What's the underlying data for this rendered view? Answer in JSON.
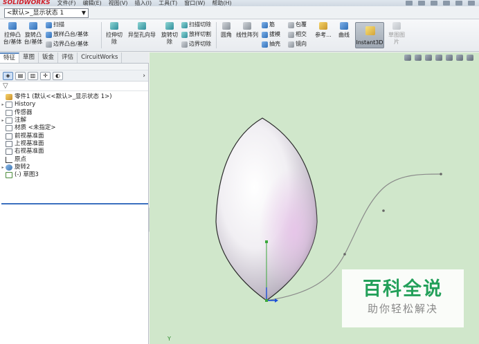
{
  "app": {
    "logo": "SOLIDWORKS",
    "menus": [
      "文件(F)",
      "编辑(E)",
      "视图(V)",
      "插入(I)",
      "工具(T)",
      "窗口(W)",
      "帮助(H)"
    ]
  },
  "config": {
    "selected": "<默认>_显示状态 1"
  },
  "ribbon": {
    "extrude_boss": "拉伸凸\n台/基体",
    "revolve_boss": "旋转凸\n台/基体",
    "sweep": "扫描",
    "loft": "放样凸台/基体",
    "boundary": "边界凸台/基体",
    "extrude_cut": "拉伸切\n除",
    "hole_wizard": "异型孔向导",
    "revolve_cut": "旋转切\n除",
    "swept_cut": "扫描切除",
    "lofted_cut": "放样切割",
    "boundary_cut": "边界切除",
    "fillet": "圆角",
    "linear_pattern": "线性阵列",
    "rib": "筋",
    "draft": "拔模",
    "shell": "抽壳",
    "wrap": "包覆",
    "intersect": "相交",
    "mirror": "镜向",
    "ref_geometry": "参考...",
    "curves": "曲线",
    "instant3d": "Instant3D",
    "sketch_picture": "草图图\n片"
  },
  "tabs": [
    "特征",
    "草图",
    "钣金",
    "评估",
    "CircuitWorks"
  ],
  "active_tab": "特征",
  "tree": [
    {
      "label": "零件1 (默认<<默认>_显示状态 1>)",
      "type": "part",
      "expandable": false
    },
    {
      "label": "History",
      "type": "folder",
      "expandable": true
    },
    {
      "label": "传感器",
      "type": "folder",
      "expandable": false
    },
    {
      "label": "注解",
      "type": "folder",
      "expandable": true
    },
    {
      "label": "材质 <未指定>",
      "type": "material",
      "expandable": false
    },
    {
      "label": "前视基准面",
      "type": "plane",
      "expandable": false
    },
    {
      "label": "上视基准面",
      "type": "plane",
      "expandable": false
    },
    {
      "label": "右视基准面",
      "type": "plane",
      "expandable": false
    },
    {
      "label": "原点",
      "type": "origin",
      "expandable": false
    },
    {
      "label": "旋转2",
      "type": "revolve",
      "expandable": true
    },
    {
      "label": "(-) 草图3",
      "type": "sketch",
      "expandable": false
    }
  ],
  "viewport": {
    "background": "#d0e7cb",
    "triad_label": "Y"
  },
  "watermark": {
    "title": "百科全说",
    "subtitle": "助你轻松解决"
  }
}
